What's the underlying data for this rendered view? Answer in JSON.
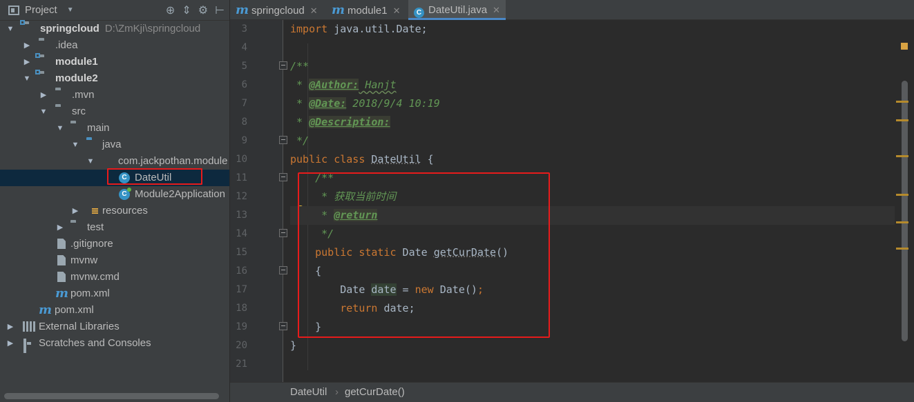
{
  "project_panel": {
    "title": "Project",
    "tools": {
      "locate_icon": "crosshair-icon",
      "collapse_icon": "collapse-all-icon",
      "settings_icon": "gear-icon",
      "hide_icon": "hide-panel-icon"
    },
    "tree": [
      {
        "label": "springcloud",
        "path": "D:\\ZmKji\\springcloud"
      },
      {
        "label": ".idea"
      },
      {
        "label": "module1"
      },
      {
        "label": "module2"
      },
      {
        "label": ".mvn"
      },
      {
        "label": "src"
      },
      {
        "label": "main"
      },
      {
        "label": "java"
      },
      {
        "label": "com.jackpothan.module"
      },
      {
        "label": "DateUtil"
      },
      {
        "label": "Module2Application"
      },
      {
        "label": "resources"
      },
      {
        "label": "test"
      },
      {
        "label": ".gitignore"
      },
      {
        "label": "mvnw"
      },
      {
        "label": "mvnw.cmd"
      },
      {
        "label": "pom.xml"
      },
      {
        "label": "pom.xml"
      },
      {
        "label": "External Libraries"
      },
      {
        "label": "Scratches and Consoles"
      }
    ]
  },
  "tabs": [
    {
      "label": "springcloud",
      "icon": "maven-module-icon"
    },
    {
      "label": "module1",
      "icon": "maven-module-icon"
    },
    {
      "label": "DateUtil.java",
      "icon": "java-class-icon",
      "active": true
    }
  ],
  "editor": {
    "line_numbers": [
      "3",
      "4",
      "5",
      "6",
      "7",
      "8",
      "9",
      "10",
      "11",
      "12",
      "13",
      "14",
      "15",
      "16",
      "17",
      "18",
      "19",
      "20",
      "21"
    ],
    "code": {
      "l3_import": "import",
      "l3_rest": " java.util.Date;",
      "l5": "/**",
      "l6_pre": " * ",
      "l6_tag": "@Author:",
      "l6_val": " Hanjt",
      "l7_pre": " * ",
      "l7_tag": "@Date:",
      "l7_val": " 2018/9/4 10:19",
      "l8_pre": " * ",
      "l8_tag": "@Description:",
      "l9": " */",
      "l10_public": "public",
      "l10_class": " class ",
      "l10_name": "DateUtil",
      "l10_brace": " {",
      "l11": "    /**",
      "l12": "     * 获取当前时间",
      "l13_pre": "     * ",
      "l13_tag": "@return",
      "l14": "     */",
      "l15_indent": "    ",
      "l15_public": "public",
      "l15_static": " static",
      "l15_type": " Date ",
      "l15_method": "getCurDate",
      "l15_paren": "()",
      "l16": "    {",
      "l17_type": "        Date ",
      "l17_var": "date",
      "l17_eq": " = ",
      "l17_new": "new",
      "l17_ctor": " Date()",
      "l17_semi": ";",
      "l18_indent": "        ",
      "l18_return": "return",
      "l18_rest": " date;",
      "l19": "    }",
      "l20": "}"
    }
  },
  "breadcrumb": {
    "class_name": "DateUtil",
    "separator": "›",
    "method_name": "getCurDate()"
  },
  "colors": {
    "highlight_box": "#e81b1b",
    "keyword": "#cc7832",
    "comment": "#629755",
    "selection": "#0d293e"
  }
}
